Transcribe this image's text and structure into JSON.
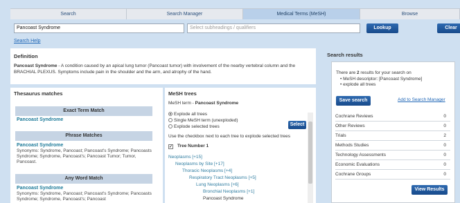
{
  "tabs": [
    {
      "label": "Search"
    },
    {
      "label": "Search Manager"
    },
    {
      "label": "Medical Terms (MeSH)"
    },
    {
      "label": "Browse"
    }
  ],
  "search": {
    "value": "Pancoast Syndrome",
    "subheadings_placeholder": "Select subheadings / qualifiers",
    "lookup_label": "Lookup",
    "clear_label": "Clear",
    "help_label": "Search Help"
  },
  "definition": {
    "heading": "Definition",
    "term": "Pancoast Syndrome",
    "text": " - A condition caused by an apical lung tumor (Pancoast tumor) with involvement of the nearby vertebral column and the BRACHIAL PLEXUS. Symptoms include pain in the shoulder and the arm, and atrophy of the hand."
  },
  "thesaurus": {
    "heading": "Thesaurus matches",
    "exact_header": "Exact Term Match",
    "exact_term": "Pancoast Syndrome",
    "phrase_header": "Phrase Matches",
    "phrase_term": "Pancoast Syndrome",
    "phrase_synonyms": "Synonyms: Syndrome, Pancoast; Pancoast's Syndrome; Pancoasts Syndrome; Syndrome, Pancoast's; Pancoast Tumor; Tumor, Pancoast.",
    "any_header": "Any Word Match",
    "any_term": "Pancoast Syndrome",
    "any_synonyms": "Synonyms: Syndrome, Pancoast; Pancoast's Syndrome; Pancoasts Syndrome; Syndrome, Pancoast's; Pancoast"
  },
  "mesh": {
    "heading": "MeSH trees",
    "term_prefix": "MeSH term - ",
    "term": "Pancoast Syndrome",
    "options": [
      "Explode all trees",
      "Single MeSH term (unexploded)",
      "Explode selected trees"
    ],
    "select_label": "Select",
    "instructions": "Use the checkbox next to each tree to explode selected trees",
    "tree_number_label": "Tree Number 1",
    "tree": [
      "Neoplasms [+15]",
      "Neoplasms by Site [+17]",
      "Thoracic Neoplasms [+4]",
      "Respiratory Tract Neoplasms [+5]",
      "Lung Neoplasms [+6]",
      "Bronchial Neoplasms [+1]",
      "Pancoast Syndrome"
    ]
  },
  "results": {
    "heading": "Search results",
    "summary_pre": "There are ",
    "summary_count": "2",
    "summary_post": " results for your search on",
    "bullet1": "MeSH descriptor: [Pancoast Syndrome]",
    "bullet2": "explode all trees",
    "search_label": "Save search",
    "add_label": "Add to Search Manager",
    "rows": [
      {
        "label": "Cochrane Reviews",
        "value": "0"
      },
      {
        "label": "Other Reviews",
        "value": "0"
      },
      {
        "label": "Trials",
        "value": "2"
      },
      {
        "label": "Methods Studies",
        "value": "0"
      },
      {
        "label": "Technology Assessments",
        "value": "0"
      },
      {
        "label": "Economic Evaluations",
        "value": "0"
      },
      {
        "label": "Cochrane Groups",
        "value": "0"
      }
    ],
    "view_label": "View Results"
  }
}
